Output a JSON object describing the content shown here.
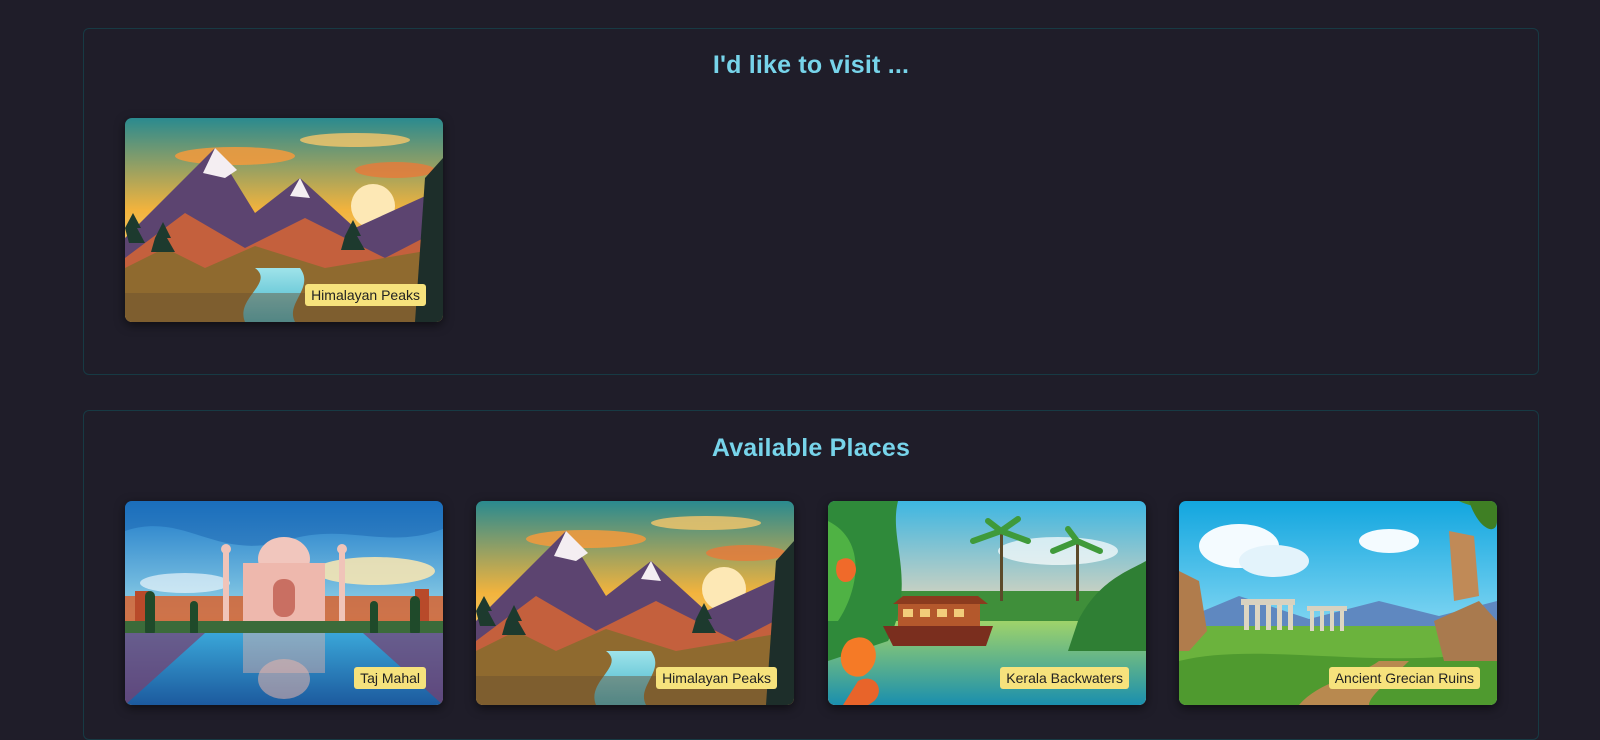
{
  "visit_section": {
    "title": "I'd like to visit ...",
    "places": [
      {
        "label": "Himalayan Peaks",
        "scene": "mountains"
      }
    ]
  },
  "available_section": {
    "title": "Available Places",
    "places": [
      {
        "label": "Taj Mahal",
        "scene": "taj"
      },
      {
        "label": "Himalayan Peaks",
        "scene": "mountains"
      },
      {
        "label": "Kerala Backwaters",
        "scene": "backwaters"
      },
      {
        "label": "Ancient Grecian Ruins",
        "scene": "ruins"
      }
    ]
  },
  "colors": {
    "background": "#1f1d29",
    "section_border": "#173a44",
    "title": "#77d4ea",
    "label_bg": "#f6e27c"
  }
}
